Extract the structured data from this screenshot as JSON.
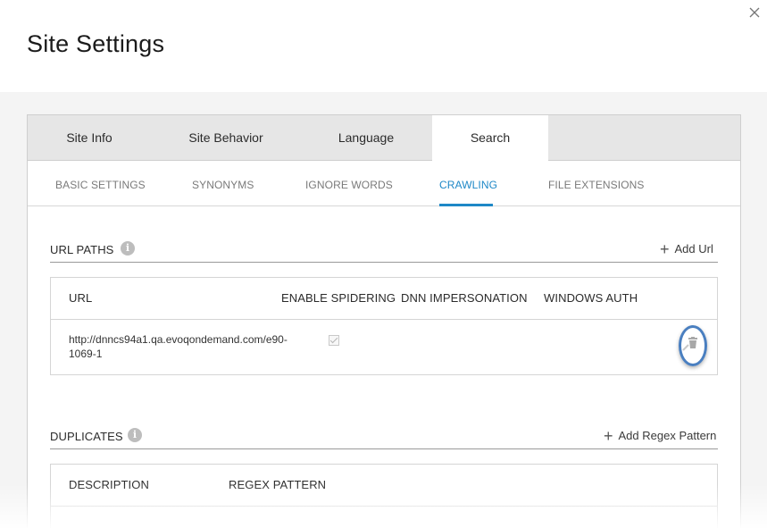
{
  "modal": {
    "title": "Site Settings",
    "close_icon": "close-icon"
  },
  "tabs": [
    {
      "label": "Site Info"
    },
    {
      "label": "Site Behavior"
    },
    {
      "label": "Language"
    },
    {
      "label": "Search",
      "active": true
    }
  ],
  "subtabs": [
    {
      "label": "BASIC SETTINGS"
    },
    {
      "label": "SYNONYMS"
    },
    {
      "label": "IGNORE WORDS"
    },
    {
      "label": "CRAWLING",
      "active": true
    },
    {
      "label": "FILE EXTENSIONS"
    }
  ],
  "url_paths": {
    "title": "URL PATHS",
    "add_label": "Add Url",
    "columns": [
      "URL",
      "ENABLE SPIDERING",
      "DNN IMPERSONATION",
      "WINDOWS AUTH"
    ],
    "rows": [
      {
        "url_line1": "http://dnncs94a1.qa.evoqondemand.com/e90-",
        "url_line2": "1069-1",
        "enable_spidering": true
      }
    ]
  },
  "duplicates": {
    "title": "DUPLICATES",
    "add_label": "Add Regex Pattern",
    "columns": [
      "DESCRIPTION",
      "REGEX PATTERN"
    ]
  },
  "colors": {
    "accent": "#1e88c7",
    "highlight_ring": "#4a7fc0",
    "tab_bar": "#e6e6e6"
  }
}
